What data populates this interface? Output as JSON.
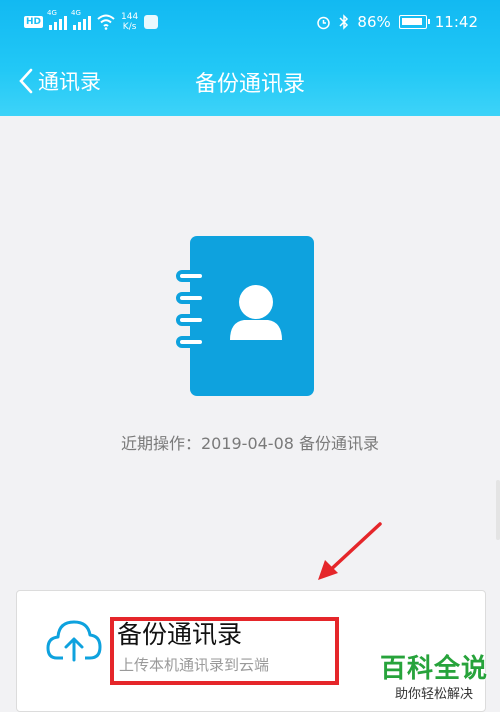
{
  "statusbar": {
    "hd": "HD",
    "net1": "4G",
    "net2": "4G",
    "speed_value": "144",
    "speed_unit": "K/s",
    "battery": "86%",
    "time": "11:42"
  },
  "nav": {
    "back_label": "通讯录",
    "title": "备份通讯录"
  },
  "main": {
    "last_operation": "近期操作：2019-04-08 备份通讯录"
  },
  "card": {
    "title": "备份通讯录",
    "subtitle": "上传本机通讯录到云端"
  },
  "watermark": {
    "main": "百科全说",
    "sub": "助你轻松解决"
  },
  "colors": {
    "header": "#1bbef4",
    "icon_blue": "#0ea2de",
    "highlight_red": "#e5262a",
    "watermark_green": "#27a33b"
  }
}
